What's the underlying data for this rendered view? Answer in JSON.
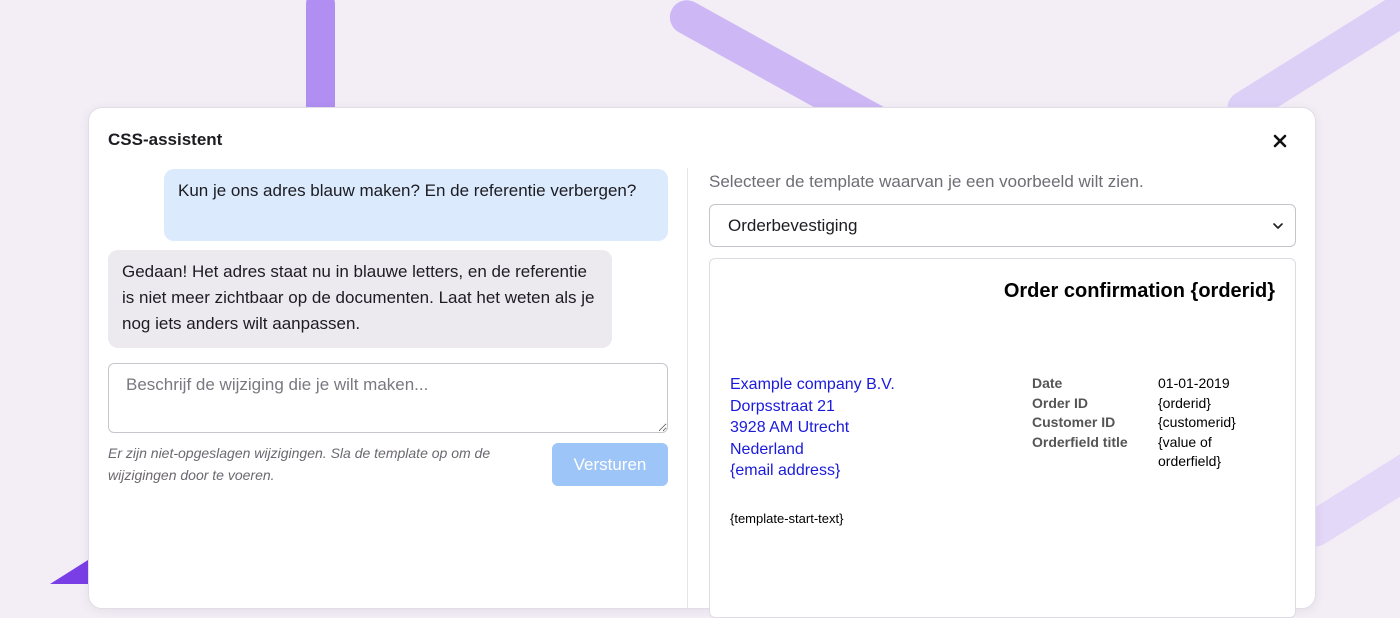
{
  "modal": {
    "title": "CSS-assistent"
  },
  "chat": {
    "messages": [
      {
        "role": "user",
        "text": "Kun je ons adres blauw maken? En de referentie verbergen?"
      },
      {
        "role": "assistant",
        "text": "Gedaan! Het adres staat nu in blauwe letters, en de referentie is niet meer zichtbaar op de documenten. Laat het weten als je nog iets anders wilt aanpassen."
      }
    ],
    "input_placeholder": "Beschrijf de wijziging die je wilt maken...",
    "input_value": "",
    "unsaved_note": "Er zijn niet-opgeslagen wijzigingen. Sla de template op om de wijzigingen door te voeren.",
    "send_label": "Versturen"
  },
  "template": {
    "label": "Selecteer de template waarvan je een voorbeeld wilt zien.",
    "selected": "Orderbevestiging"
  },
  "preview": {
    "title": "Order confirmation {orderid}",
    "address_lines": [
      "Example company B.V.",
      "Dorpsstraat 21",
      "3928 AM Utrecht",
      "Nederland",
      "{email address}"
    ],
    "meta": [
      {
        "label": "Date",
        "value": "01-01-2019"
      },
      {
        "label": "Order ID",
        "value": "{orderid}"
      },
      {
        "label": "Customer ID",
        "value": "{customerid}"
      },
      {
        "label": "Orderfield title",
        "value": "{value of orderfield}"
      }
    ],
    "start_text": "{template-start-text}"
  },
  "colors": {
    "accent_purple": "#b18ff2",
    "user_bubble": "#dbeafc",
    "assistant_bubble": "#eceaef",
    "send_button": "#9ec5f7",
    "address_blue": "#1a1adb"
  },
  "icons": {
    "close": "close-icon",
    "select": "chevron-down-icon"
  }
}
